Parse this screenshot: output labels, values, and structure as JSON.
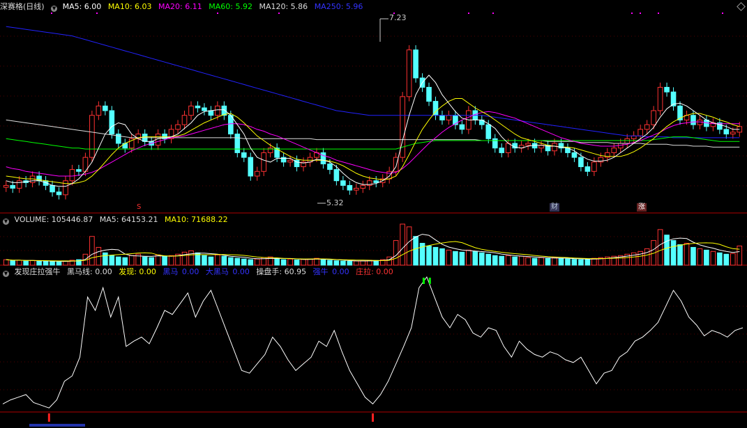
{
  "price_panel": {
    "title": "深赛格(日线)",
    "indicators": [
      {
        "label": "MA5: 6.00",
        "color": "#ffffff"
      },
      {
        "label": "MA10: 6.03",
        "color": "#ffff00"
      },
      {
        "label": "MA20: 6.11",
        "color": "#ff00ff"
      },
      {
        "label": "MA60: 5.92",
        "color": "#00ff00"
      },
      {
        "label": "MA120: 5.86",
        "color": "#dddddd"
      },
      {
        "label": "MA250: 5.96",
        "color": "#2222ff"
      }
    ],
    "high_label": "7.23",
    "low_label": "5.32",
    "markers": [
      {
        "label": "S",
        "style": "red"
      },
      {
        "label": "财",
        "style": "blue"
      },
      {
        "label": "涨",
        "style": "redbg"
      }
    ]
  },
  "volume_panel": {
    "indicators": [
      {
        "label": "VOLUME: 105446.87",
        "color": "#dddddd"
      },
      {
        "label": "MA5: 64153.21",
        "color": "#dddddd"
      },
      {
        "label": "MA10: 71688.22",
        "color": "#ffff00"
      }
    ]
  },
  "indicator_panel": {
    "indicators": [
      {
        "label": "发现庄拉强牛",
        "color": "#dddddd"
      },
      {
        "label": "黑马线: 0.00",
        "color": "#dddddd"
      },
      {
        "label": "发现: 0.00",
        "color": "#ffff00"
      },
      {
        "label": "黑马",
        "color": "#2222ff"
      },
      {
        "label": "0.00",
        "color": "#2222ff"
      },
      {
        "label": "大黑马",
        "color": "#2222ff"
      },
      {
        "label": "0.00",
        "color": "#2222ff"
      },
      {
        "label": "操盘手: 60.95",
        "color": "#dddddd"
      },
      {
        "label": "强牛",
        "color": "#2222ff"
      },
      {
        "label": "0.00",
        "color": "#2222ff"
      },
      {
        "label": "庄拉: 0.00",
        "color": "#ff3030"
      }
    ]
  },
  "chart_data": {
    "type": "candlestick",
    "price_ylim": [
      5.2,
      7.3
    ],
    "up_color": "#ff3232",
    "down_color": "#54ffff",
    "close": [
      5.45,
      5.42,
      5.5,
      5.48,
      5.55,
      5.5,
      5.45,
      5.38,
      5.35,
      5.5,
      5.62,
      5.6,
      5.75,
      6.2,
      6.3,
      6.25,
      6.0,
      5.9,
      5.85,
      5.95,
      6.0,
      5.92,
      5.88,
      6.0,
      5.95,
      6.05,
      6.1,
      6.2,
      6.3,
      6.28,
      6.25,
      6.2,
      6.3,
      6.2,
      6.0,
      5.8,
      5.75,
      5.55,
      5.6,
      5.8,
      5.85,
      5.75,
      5.7,
      5.72,
      5.65,
      5.7,
      5.75,
      5.8,
      5.68,
      5.62,
      5.5,
      5.45,
      5.4,
      5.42,
      5.45,
      5.5,
      5.48,
      5.52,
      5.6,
      5.75,
      6.4,
      6.9,
      6.6,
      6.5,
      6.35,
      6.2,
      6.15,
      6.2,
      6.1,
      6.05,
      6.25,
      6.15,
      6.1,
      5.95,
      5.85,
      5.8,
      5.9,
      5.85,
      5.88,
      5.9,
      5.85,
      5.88,
      5.82,
      5.9,
      5.85,
      5.8,
      5.75,
      5.65,
      5.6,
      5.7,
      5.75,
      5.8,
      5.85,
      5.9,
      5.95,
      5.98,
      6.05,
      6.1,
      6.25,
      6.5,
      6.45,
      6.3,
      6.15,
      6.2,
      6.1,
      6.15,
      6.08,
      6.12,
      6.05,
      6.0,
      6.02,
      6.08
    ],
    "volume": [
      40,
      32,
      36,
      30,
      34,
      28,
      30,
      26,
      24,
      30,
      36,
      40,
      80,
      210,
      130,
      90,
      70,
      60,
      55,
      70,
      80,
      60,
      55,
      75,
      65,
      70,
      80,
      95,
      105,
      90,
      70,
      60,
      75,
      65,
      55,
      50,
      45,
      40,
      45,
      55,
      60,
      45,
      40,
      45,
      38,
      42,
      45,
      50,
      40,
      35,
      32,
      30,
      28,
      30,
      32,
      36,
      34,
      40,
      60,
      180,
      300,
      280,
      210,
      160,
      140,
      130,
      120,
      110,
      100,
      95,
      110,
      100,
      90,
      80,
      70,
      65,
      70,
      60,
      65,
      55,
      50,
      55,
      48,
      55,
      50,
      45,
      42,
      40,
      45,
      50,
      55,
      60,
      65,
      70,
      80,
      90,
      100,
      120,
      180,
      260,
      220,
      180,
      150,
      160,
      130,
      120,
      110,
      100,
      90,
      80,
      85,
      140
    ],
    "indicator_ylim": [
      0,
      100
    ],
    "indicator_values": [
      5,
      8,
      10,
      12,
      6,
      4,
      2,
      8,
      22,
      26,
      40,
      85,
      75,
      92,
      70,
      85,
      48,
      52,
      55,
      50,
      62,
      75,
      72,
      80,
      88,
      70,
      82,
      90,
      75,
      60,
      45,
      30,
      28,
      35,
      42,
      55,
      48,
      38,
      30,
      35,
      40,
      52,
      48,
      60,
      44,
      30,
      20,
      10,
      5,
      12,
      22,
      35,
      48,
      62,
      92,
      100,
      85,
      70,
      62,
      72,
      68,
      58,
      55,
      62,
      60,
      48,
      40,
      52,
      46,
      42,
      40,
      44,
      42,
      38,
      36,
      40,
      30,
      20,
      28,
      30,
      40,
      44,
      52,
      55,
      60,
      66,
      78,
      90,
      82,
      70,
      64,
      56,
      60,
      58,
      55,
      60,
      62
    ],
    "ma5": [
      5.5,
      5.48,
      5.48,
      5.49,
      5.5,
      5.5,
      5.48,
      5.45,
      5.44,
      5.44,
      5.47,
      5.52,
      5.6,
      5.7,
      5.85,
      6.0,
      6.08,
      6.12,
      6.1,
      6.0,
      5.95,
      5.92,
      5.92,
      5.95,
      5.96,
      5.97,
      6.0,
      6.06,
      6.12,
      6.2,
      6.24,
      6.25,
      6.26,
      6.26,
      6.2,
      6.1,
      6.0,
      5.85,
      5.75,
      5.72,
      5.7,
      5.74,
      5.74,
      5.74,
      5.7,
      5.69,
      5.7,
      5.73,
      5.72,
      5.7,
      5.65,
      5.58,
      5.52,
      5.48,
      5.46,
      5.46,
      5.47,
      5.5,
      5.55,
      5.65,
      5.93,
      6.2,
      6.42,
      6.55,
      6.63,
      6.55,
      6.42,
      6.33,
      6.24,
      6.17,
      6.15,
      6.15,
      6.15,
      6.11,
      6.06,
      5.97,
      5.9,
      5.86,
      5.85,
      5.87,
      5.88,
      5.88,
      5.87,
      5.87,
      5.86,
      5.85,
      5.82,
      5.77,
      5.73,
      5.71,
      5.71,
      5.72,
      5.75,
      5.8,
      5.85,
      5.9,
      5.95,
      6.0,
      6.07,
      6.18,
      6.27,
      6.32,
      6.33,
      6.3,
      6.25,
      6.2,
      6.15,
      6.12,
      6.1,
      6.08,
      6.05,
      6.05
    ],
    "ma10": [
      5.55,
      5.54,
      5.53,
      5.52,
      5.52,
      5.51,
      5.5,
      5.49,
      5.48,
      5.47,
      5.47,
      5.48,
      5.5,
      5.55,
      5.62,
      5.7,
      5.78,
      5.85,
      5.9,
      5.93,
      5.96,
      5.97,
      5.97,
      5.97,
      5.97,
      5.97,
      5.98,
      6.0,
      6.04,
      6.08,
      6.12,
      6.15,
      6.18,
      6.21,
      6.22,
      6.18,
      6.12,
      6.05,
      5.98,
      5.93,
      5.88,
      5.84,
      5.8,
      5.76,
      5.73,
      5.72,
      5.72,
      5.72,
      5.72,
      5.71,
      5.69,
      5.66,
      5.62,
      5.58,
      5.55,
      5.53,
      5.52,
      5.51,
      5.52,
      5.55,
      5.65,
      5.78,
      5.92,
      6.05,
      6.15,
      6.24,
      6.3,
      6.35,
      6.38,
      6.38,
      6.33,
      6.28,
      6.24,
      6.2,
      6.15,
      6.1,
      6.05,
      6.0,
      5.96,
      5.94,
      5.92,
      5.9,
      5.88,
      5.87,
      5.86,
      5.86,
      5.85,
      5.83,
      5.81,
      5.79,
      5.77,
      5.76,
      5.76,
      5.76,
      5.78,
      5.81,
      5.85,
      5.9,
      5.95,
      6.02,
      6.08,
      6.13,
      6.17,
      6.2,
      6.22,
      6.22,
      6.2,
      6.18,
      6.15,
      6.13,
      6.1,
      6.08
    ],
    "ma20": [
      5.65,
      5.63,
      5.62,
      5.6,
      5.59,
      5.58,
      5.57,
      5.56,
      5.55,
      5.55,
      5.55,
      5.56,
      5.57,
      5.59,
      5.62,
      5.66,
      5.7,
      5.74,
      5.78,
      5.82,
      5.85,
      5.88,
      5.9,
      5.92,
      5.94,
      5.96,
      5.97,
      5.98,
      6.0,
      6.02,
      6.04,
      6.06,
      6.08,
      6.1,
      6.11,
      6.11,
      6.1,
      6.08,
      6.05,
      6.03,
      6.0,
      5.98,
      5.95,
      5.92,
      5.89,
      5.86,
      5.83,
      5.8,
      5.77,
      5.75,
      5.72,
      5.7,
      5.68,
      5.66,
      5.64,
      5.62,
      5.6,
      5.59,
      5.58,
      5.59,
      5.63,
      5.69,
      5.76,
      5.83,
      5.9,
      5.96,
      6.02,
      6.07,
      6.11,
      6.15,
      6.18,
      6.21,
      6.23,
      6.24,
      6.23,
      6.21,
      6.19,
      6.17,
      6.14,
      6.11,
      6.08,
      6.05,
      6.02,
      5.99,
      5.96,
      5.94,
      5.92,
      5.9,
      5.89,
      5.88,
      5.87,
      5.87,
      5.87,
      5.88,
      5.89,
      5.91,
      5.93,
      5.96,
      5.99,
      6.02,
      6.06,
      6.09,
      6.11,
      6.12,
      6.13,
      6.13,
      6.12,
      6.11,
      6.11,
      6.11,
      6.11,
      6.11
    ],
    "ma60": [
      5.95,
      5.94,
      5.93,
      5.92,
      5.91,
      5.9,
      5.89,
      5.88,
      5.87,
      5.86,
      5.85,
      5.85,
      5.84,
      5.84,
      5.84,
      5.84,
      5.84,
      5.84,
      5.84,
      5.84,
      5.84,
      5.84,
      5.84,
      5.84,
      5.84,
      5.84,
      5.84,
      5.84,
      5.84,
      5.84,
      5.84,
      5.84,
      5.84,
      5.84,
      5.84,
      5.84,
      5.84,
      5.84,
      5.84,
      5.84,
      5.84,
      5.84,
      5.84,
      5.84,
      5.84,
      5.84,
      5.84,
      5.84,
      5.84,
      5.84,
      5.84,
      5.84,
      5.84,
      5.84,
      5.84,
      5.84,
      5.84,
      5.84,
      5.84,
      5.84,
      5.86,
      5.88,
      5.9,
      5.91,
      5.92,
      5.93,
      5.93,
      5.93,
      5.93,
      5.93,
      5.93,
      5.93,
      5.93,
      5.93,
      5.93,
      5.93,
      5.93,
      5.93,
      5.93,
      5.93,
      5.93,
      5.93,
      5.93,
      5.93,
      5.93,
      5.93,
      5.93,
      5.93,
      5.93,
      5.93,
      5.93,
      5.93,
      5.93,
      5.93,
      5.93,
      5.93,
      5.93,
      5.93,
      5.94,
      5.95,
      5.96,
      5.97,
      5.97,
      5.97,
      5.96,
      5.95,
      5.94,
      5.93,
      5.92,
      5.92,
      5.92,
      5.92
    ],
    "ma120": [
      6.15,
      6.14,
      6.13,
      6.12,
      6.11,
      6.1,
      6.09,
      6.08,
      6.07,
      6.06,
      6.05,
      6.04,
      6.03,
      6.02,
      6.01,
      6.0,
      5.99,
      5.98,
      5.97,
      5.96,
      5.96,
      5.96,
      5.96,
      5.96,
      5.96,
      5.96,
      5.96,
      5.96,
      5.96,
      5.96,
      5.96,
      5.96,
      5.96,
      5.96,
      5.96,
      5.96,
      5.95,
      5.95,
      5.95,
      5.95,
      5.95,
      5.95,
      5.95,
      5.95,
      5.95,
      5.95,
      5.95,
      5.94,
      5.94,
      5.94,
      5.94,
      5.94,
      5.94,
      5.94,
      5.94,
      5.94,
      5.94,
      5.94,
      5.94,
      5.94,
      5.94,
      5.94,
      5.94,
      5.94,
      5.94,
      5.94,
      5.94,
      5.94,
      5.94,
      5.94,
      5.94,
      5.94,
      5.93,
      5.93,
      5.93,
      5.93,
      5.93,
      5.93,
      5.93,
      5.93,
      5.93,
      5.93,
      5.92,
      5.92,
      5.92,
      5.92,
      5.92,
      5.91,
      5.91,
      5.91,
      5.91,
      5.91,
      5.9,
      5.9,
      5.9,
      5.9,
      5.9,
      5.89,
      5.89,
      5.89,
      5.89,
      5.88,
      5.88,
      5.88,
      5.87,
      5.87,
      5.87,
      5.86,
      5.86,
      5.86,
      5.86,
      5.86
    ],
    "ma250": [
      7.15,
      7.14,
      7.13,
      7.12,
      7.11,
      7.1,
      7.09,
      7.08,
      7.07,
      7.06,
      7.05,
      7.03,
      7.01,
      6.99,
      6.97,
      6.95,
      6.93,
      6.91,
      6.89,
      6.87,
      6.85,
      6.83,
      6.81,
      6.79,
      6.77,
      6.75,
      6.73,
      6.71,
      6.69,
      6.67,
      6.65,
      6.63,
      6.61,
      6.59,
      6.57,
      6.55,
      6.53,
      6.51,
      6.49,
      6.47,
      6.45,
      6.43,
      6.41,
      6.39,
      6.37,
      6.35,
      6.33,
      6.31,
      6.29,
      6.27,
      6.25,
      6.24,
      6.23,
      6.22,
      6.21,
      6.2,
      6.2,
      6.2,
      6.2,
      6.2,
      6.2,
      6.2,
      6.2,
      6.2,
      6.2,
      6.2,
      6.2,
      6.2,
      6.2,
      6.2,
      6.2,
      6.2,
      6.2,
      6.19,
      6.18,
      6.17,
      6.16,
      6.15,
      6.14,
      6.13,
      6.12,
      6.11,
      6.1,
      6.09,
      6.08,
      6.07,
      6.06,
      6.05,
      6.04,
      6.03,
      6.02,
      6.01,
      6.0,
      5.99,
      5.98,
      5.98,
      5.98,
      5.97,
      5.97,
      5.97,
      5.97,
      5.96,
      5.96,
      5.96,
      5.96,
      5.96,
      5.96,
      5.96,
      5.96,
      5.96,
      5.96,
      5.96
    ]
  }
}
